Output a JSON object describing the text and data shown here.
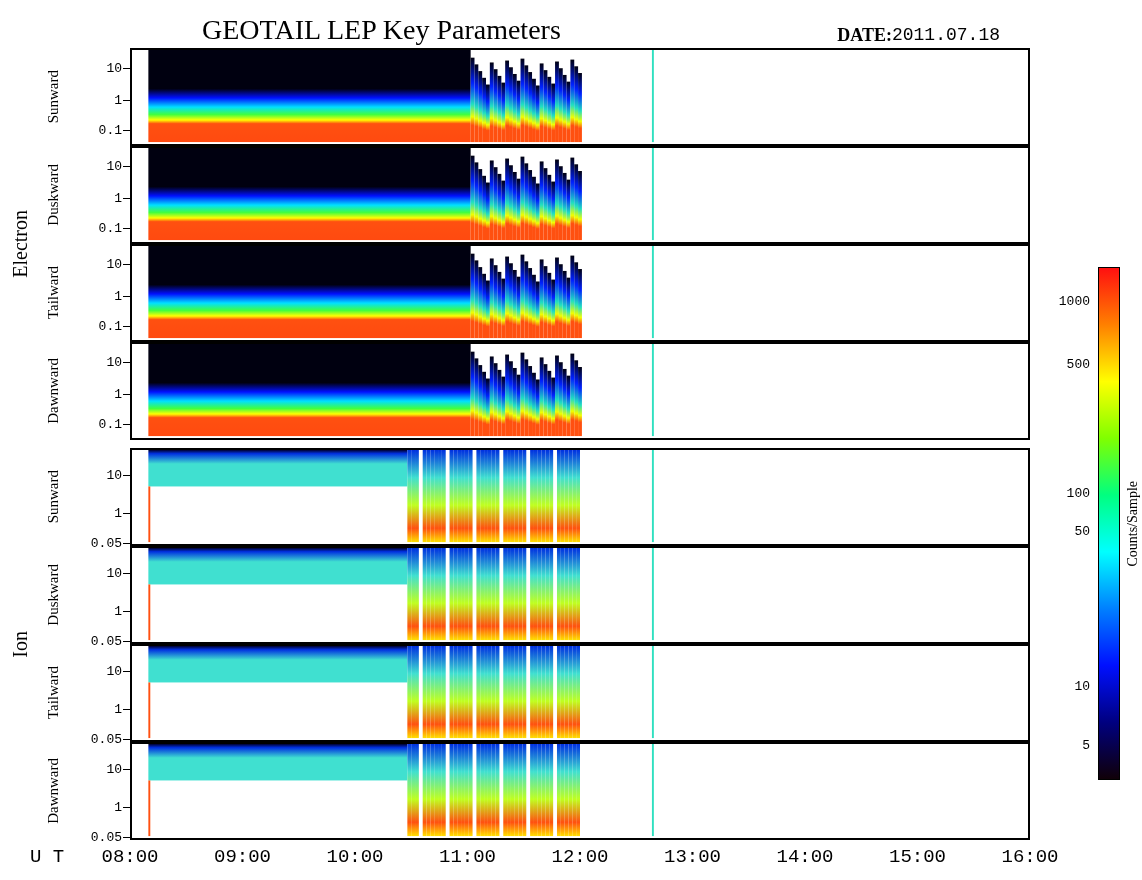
{
  "title": "GEOTAIL LEP Key Parameters",
  "date": {
    "label": "DATE:",
    "value": "2011.07.18"
  },
  "groups": [
    {
      "label": "Electron",
      "kind": "electron",
      "panels": [
        {
          "label": "Sunward",
          "ticks": [
            "10",
            "1",
            "0.1"
          ]
        },
        {
          "label": "Duskward",
          "ticks": [
            "10",
            "1",
            "0.1"
          ]
        },
        {
          "label": "Tailward",
          "ticks": [
            "10",
            "1",
            "0.1"
          ]
        },
        {
          "label": "Dawnward",
          "ticks": [
            "10",
            "1",
            "0.1"
          ]
        }
      ]
    },
    {
      "label": "Ion",
      "kind": "ion",
      "panels": [
        {
          "label": "Sunward",
          "ticks": [
            "10",
            "1",
            "0.05"
          ]
        },
        {
          "label": "Duskward",
          "ticks": [
            "10",
            "1",
            "0.05"
          ]
        },
        {
          "label": "Tailward",
          "ticks": [
            "10",
            "1",
            "0.05"
          ]
        },
        {
          "label": "Dawnward",
          "ticks": [
            "10",
            "1",
            "0.05"
          ]
        }
      ]
    }
  ],
  "time_axis": {
    "label": "U T",
    "ticks": [
      "08:00",
      "09:00",
      "10:00",
      "11:00",
      "12:00",
      "13:00",
      "14:00",
      "15:00",
      "16:00"
    ]
  },
  "colorbar": {
    "title": "Counts/Sample",
    "ticks": [
      "1000",
      "500",
      "100",
      "50",
      "10",
      "5"
    ]
  }
}
